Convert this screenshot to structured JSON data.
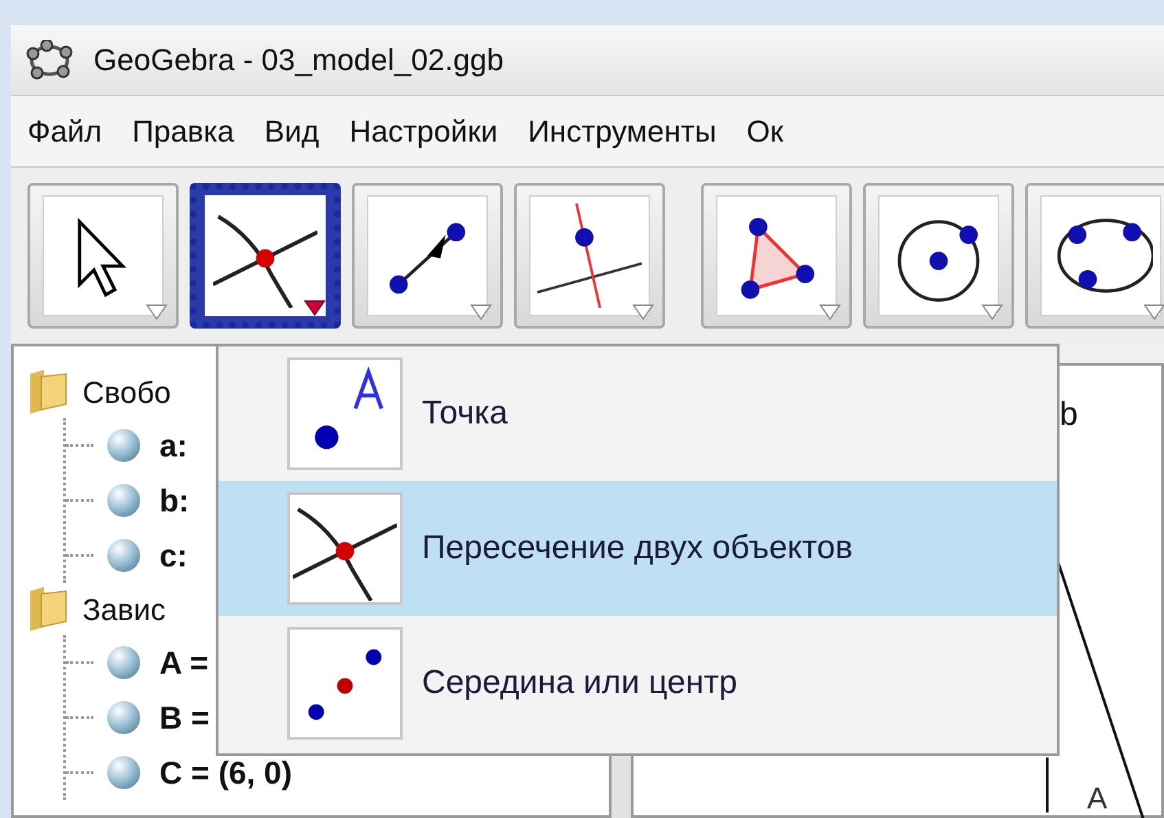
{
  "window": {
    "title": "GeoGebra - 03_model_02.ggb"
  },
  "menu": [
    {
      "label": "Файл"
    },
    {
      "label": "Правка"
    },
    {
      "label": "Вид"
    },
    {
      "label": "Настройки"
    },
    {
      "label": "Инструменты"
    },
    {
      "label": "Ок"
    }
  ],
  "toolbar": [
    {
      "kind": "move",
      "selected": false
    },
    {
      "kind": "intersect",
      "selected": true
    },
    {
      "kind": "segment",
      "selected": false
    },
    {
      "kind": "perpendicular",
      "selected": false
    },
    {
      "kind": "polygon",
      "selected": false
    },
    {
      "kind": "circle",
      "selected": false
    },
    {
      "kind": "conic",
      "selected": false
    }
  ],
  "dropdown": {
    "items": [
      {
        "kind": "point",
        "label": "Точка",
        "selected": false
      },
      {
        "kind": "intersect",
        "label": "Пересечение двух объектов",
        "selected": true
      },
      {
        "kind": "midpoint",
        "label": "Середина или центр",
        "selected": false
      }
    ]
  },
  "algebra": {
    "folders": [
      {
        "label": "Свобо",
        "children": [
          {
            "label": "a:"
          },
          {
            "label": "b:"
          },
          {
            "label": "c:"
          }
        ]
      },
      {
        "label": "Завис",
        "children": [
          {
            "label": "A ="
          },
          {
            "label": "B ="
          },
          {
            "label": "C = (6, 0)"
          }
        ]
      }
    ]
  },
  "graphics": {
    "labels": [
      {
        "text": "b"
      },
      {
        "text": "A"
      }
    ]
  }
}
